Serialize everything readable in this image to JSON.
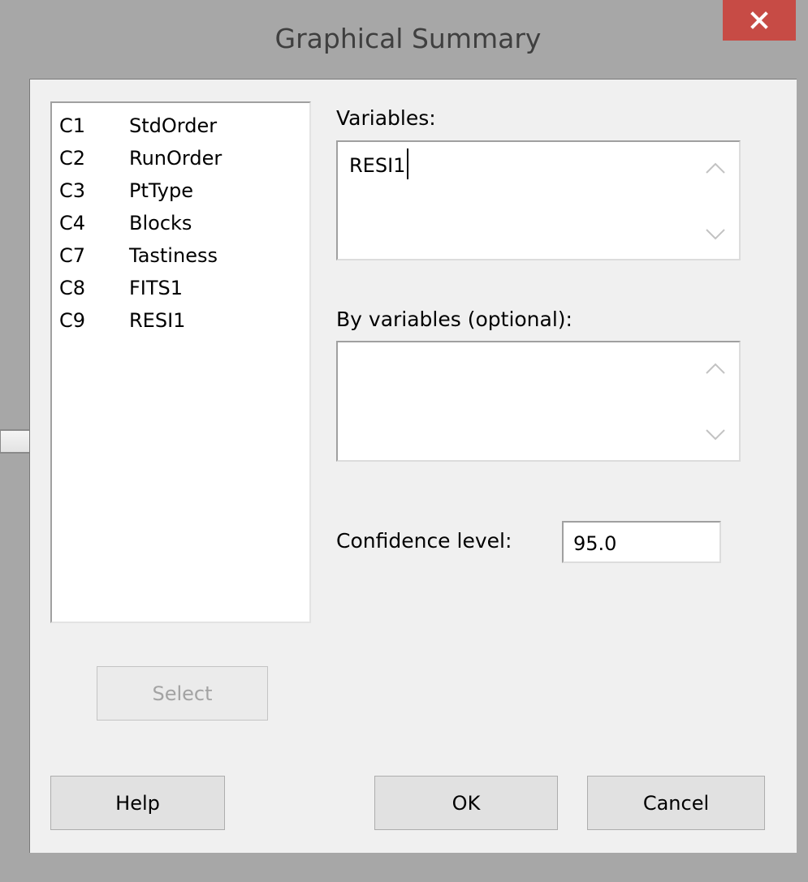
{
  "window": {
    "title": "Graphical Summary"
  },
  "variables_list": [
    {
      "id": "C1",
      "name": "StdOrder"
    },
    {
      "id": "C2",
      "name": "RunOrder"
    },
    {
      "id": "C3",
      "name": "PtType"
    },
    {
      "id": "C4",
      "name": "Blocks"
    },
    {
      "id": "C7",
      "name": "Tastiness"
    },
    {
      "id": "C8",
      "name": "FITS1"
    },
    {
      "id": "C9",
      "name": "RESI1"
    }
  ],
  "variables_field": {
    "label": "Variables:",
    "value": "RESI1"
  },
  "by_variables_field": {
    "label": "By variables (optional):",
    "value": ""
  },
  "confidence": {
    "label": "Confidence level:",
    "value": "95.0"
  },
  "buttons": {
    "select": "Select",
    "help": "Help",
    "ok": "OK",
    "cancel": "Cancel"
  },
  "colors": {
    "close_button": "#c74b45",
    "frame": "#a7a7a7",
    "client": "#f0f0f0"
  }
}
